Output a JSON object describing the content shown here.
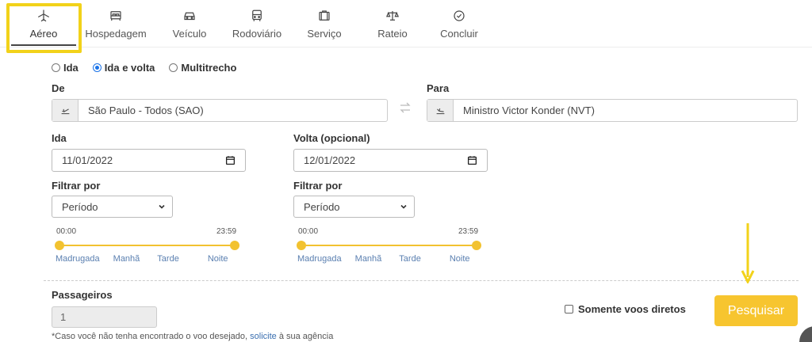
{
  "tabs": [
    {
      "label": "Aéreo",
      "icon": "airplane-icon",
      "active": true
    },
    {
      "label": "Hospedagem",
      "icon": "bed-icon"
    },
    {
      "label": "Veículo",
      "icon": "car-icon"
    },
    {
      "label": "Rodoviário",
      "icon": "bus-icon"
    },
    {
      "label": "Serviço",
      "icon": "briefcase-icon"
    },
    {
      "label": "Rateio",
      "icon": "scale-icon"
    },
    {
      "label": "Concluir",
      "icon": "check-circle-icon"
    }
  ],
  "trip_type": {
    "options": [
      "Ida",
      "Ida e volta",
      "Multitrecho"
    ],
    "selected": "Ida e volta"
  },
  "from": {
    "label": "De",
    "value": "São Paulo - Todos (SAO)",
    "icon": "plane-departure-icon"
  },
  "to": {
    "label": "Para",
    "value": "Ministro Victor Konder (NVT)",
    "icon": "plane-arrival-icon"
  },
  "depart": {
    "label": "Ida",
    "value": "11/01/2022"
  },
  "return": {
    "label": "Volta (opcional)",
    "value": "12/01/2022"
  },
  "filter_depart": {
    "label": "Filtrar por",
    "selected": "Período",
    "time_start": "00:00",
    "time_end": "23:59",
    "periods": [
      "Madrugada",
      "Manhã",
      "Tarde",
      "Noite"
    ]
  },
  "filter_return": {
    "label": "Filtrar por",
    "selected": "Período",
    "time_start": "00:00",
    "time_end": "23:59",
    "periods": [
      "Madrugada",
      "Manhã",
      "Tarde",
      "Noite"
    ]
  },
  "passengers": {
    "label": "Passageiros",
    "value": "1"
  },
  "direct_only": {
    "label": "Somente voos diretos",
    "checked": false
  },
  "search_button": "Pesquisar",
  "note": {
    "prefix": "*Caso você não tenha encontrado o voo desejado,",
    "link": "solicite",
    "suffix": "à sua agência"
  },
  "colors": {
    "accent": "#f7c52f",
    "highlight": "#f2d21a",
    "radio": "#1a73e8",
    "period_text": "#5a7fb0"
  }
}
